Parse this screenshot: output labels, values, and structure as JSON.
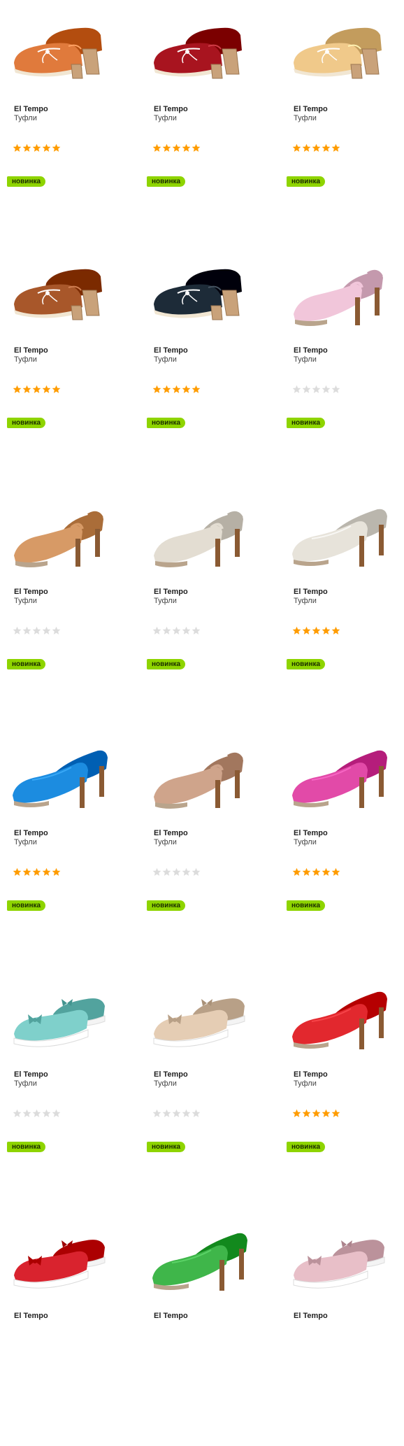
{
  "products": [
    {
      "brand": "El Tempo",
      "type": "Туфли",
      "rating": 5,
      "badge": "новинка",
      "color": "#e07a3c",
      "style": "loafer"
    },
    {
      "brand": "El Tempo",
      "type": "Туфли",
      "rating": 5,
      "badge": "новинка",
      "color": "#a8141f",
      "style": "loafer"
    },
    {
      "brand": "El Tempo",
      "type": "Туфли",
      "rating": 5,
      "badge": "новинка",
      "color": "#f0c98a",
      "style": "loafer"
    },
    {
      "brand": "El Tempo",
      "type": "Туфли",
      "rating": 5,
      "badge": "новинка",
      "color": "#a8572a",
      "style": "loafer"
    },
    {
      "brand": "El Tempo",
      "type": "Туфли",
      "rating": 5,
      "badge": "новинка",
      "color": "#1d2b38",
      "style": "loafer"
    },
    {
      "brand": "El Tempo",
      "type": "Туфли",
      "rating": 0,
      "badge": "новинка",
      "color": "#f1c6da",
      "style": "slingback"
    },
    {
      "brand": "El Tempo",
      "type": "Туфли",
      "rating": 0,
      "badge": "новинка",
      "color": "#d79a66",
      "style": "slingback"
    },
    {
      "brand": "El Tempo",
      "type": "Туфли",
      "rating": 0,
      "badge": "новинка",
      "color": "#e3ddd2",
      "style": "slingback"
    },
    {
      "brand": "El Tempo",
      "type": "Туфли",
      "rating": 5,
      "badge": "новинка",
      "color": "#e7e3da",
      "style": "pump"
    },
    {
      "brand": "El Tempo",
      "type": "Туфли",
      "rating": 5,
      "badge": "новинка",
      "color": "#1c8ce0",
      "style": "pump"
    },
    {
      "brand": "El Tempo",
      "type": "Туфли",
      "rating": 0,
      "badge": "новинка",
      "color": "#cfa48b",
      "style": "slingback"
    },
    {
      "brand": "El Tempo",
      "type": "Туфли",
      "rating": 5,
      "badge": "новинка",
      "color": "#e24aa8",
      "style": "pump"
    },
    {
      "brand": "El Tempo",
      "type": "Туфли",
      "rating": 0,
      "badge": "новинка",
      "color": "#7fd0cb",
      "style": "wedge"
    },
    {
      "brand": "El Tempo",
      "type": "Туфли",
      "rating": 0,
      "badge": "новинка",
      "color": "#e5cdb4",
      "style": "wedge"
    },
    {
      "brand": "El Tempo",
      "type": "Туфли",
      "rating": 5,
      "badge": "новинка",
      "color": "#e2282e",
      "style": "pump"
    },
    {
      "brand": "El Tempo",
      "type": "",
      "rating": null,
      "badge": "",
      "color": "#d9232e",
      "style": "wedge"
    },
    {
      "brand": "El Tempo",
      "type": "",
      "rating": null,
      "badge": "",
      "color": "#3fb64a",
      "style": "pump"
    },
    {
      "brand": "El Tempo",
      "type": "",
      "rating": null,
      "badge": "",
      "color": "#e8bfc8",
      "style": "wedge"
    }
  ],
  "colors": {
    "star_on": "#ff9c00",
    "star_off": "#dcdcdc",
    "badge_bg": "#8ed400"
  }
}
